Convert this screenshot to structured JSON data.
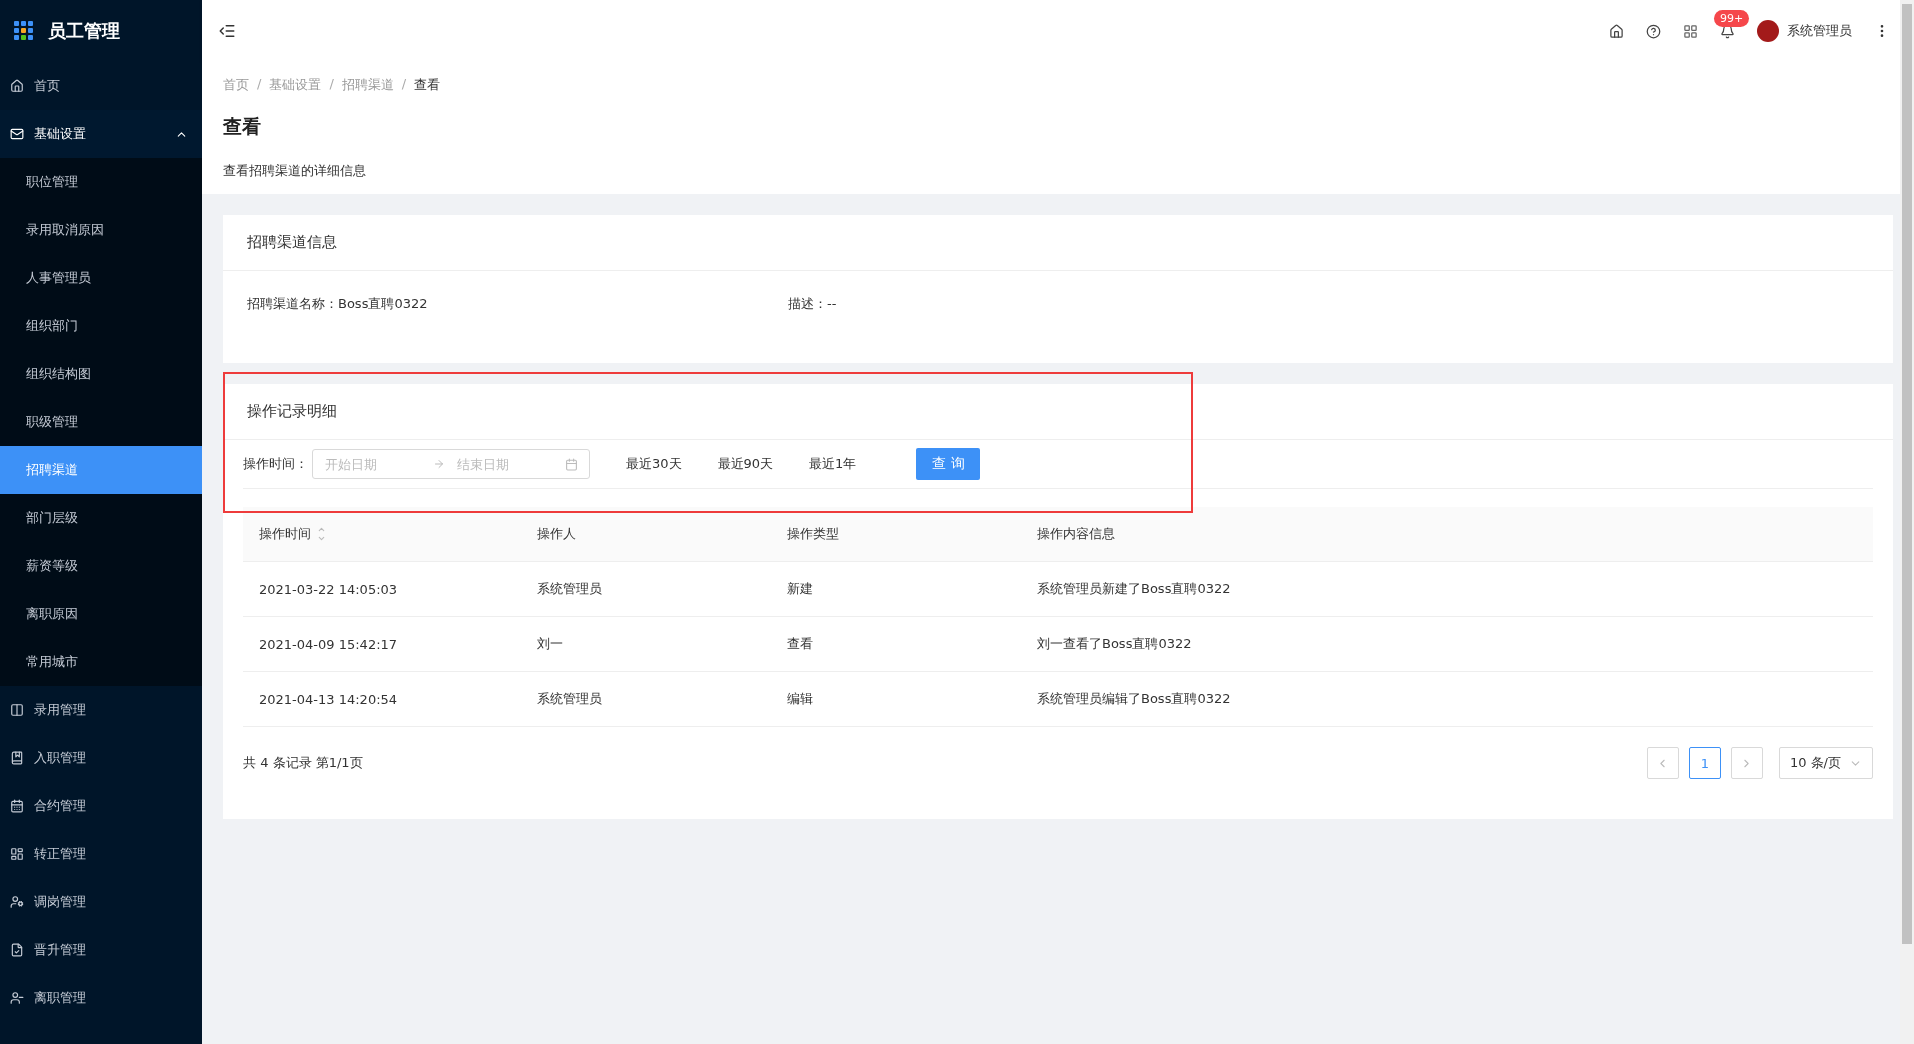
{
  "sidebar": {
    "logo": "员工管理",
    "items": [
      {
        "label": "首页",
        "expanded": false
      },
      {
        "label": "基础设置",
        "expanded": true,
        "children": [
          {
            "label": "职位管理",
            "selected": false
          },
          {
            "label": "录用取消原因",
            "selected": false
          },
          {
            "label": "人事管理员",
            "selected": false
          },
          {
            "label": "组织部门",
            "selected": false
          },
          {
            "label": "组织结构图",
            "selected": false
          },
          {
            "label": "职级管理",
            "selected": false
          },
          {
            "label": "招聘渠道",
            "selected": true
          },
          {
            "label": "部门层级",
            "selected": false
          },
          {
            "label": "薪资等级",
            "selected": false
          },
          {
            "label": "离职原因",
            "selected": false
          },
          {
            "label": "常用城市",
            "selected": false
          }
        ]
      },
      {
        "label": "录用管理",
        "expanded": false
      },
      {
        "label": "入职管理",
        "expanded": false
      },
      {
        "label": "合约管理",
        "expanded": false
      },
      {
        "label": "转正管理",
        "expanded": false
      },
      {
        "label": "调岗管理",
        "expanded": false
      },
      {
        "label": "晋升管理",
        "expanded": false
      },
      {
        "label": "离职管理",
        "expanded": false
      }
    ]
  },
  "header": {
    "notification_badge": "99+",
    "user": "系统管理员"
  },
  "breadcrumb": {
    "separator": "/",
    "items": [
      "首页",
      "基础设置",
      "招聘渠道",
      "查看"
    ]
  },
  "page_title": "查看",
  "page_subtitle": "查看招聘渠道的详细信息",
  "info_card": {
    "title": "招聘渠道信息",
    "fields": [
      {
        "label": "招聘渠道名称：",
        "value": "Boss直聘0322"
      },
      {
        "label": "描述：",
        "value": "--"
      }
    ]
  },
  "records_card": {
    "title": "操作记录明细",
    "filter": {
      "label": "操作时间：",
      "start_placeholder": "开始日期",
      "end_placeholder": "结束日期",
      "quick_ranges": [
        "最近30天",
        "最近90天",
        "最近1年"
      ],
      "query_button": "查 询"
    },
    "table": {
      "columns": [
        {
          "label": "操作时间",
          "sortable": true
        },
        {
          "label": "操作人",
          "sortable": false
        },
        {
          "label": "操作类型",
          "sortable": false
        },
        {
          "label": "操作内容信息",
          "sortable": false
        }
      ],
      "rows": [
        [
          "2021-03-22 14:05:03",
          "系统管理员",
          "新建",
          "系统管理员新建了Boss直聘0322"
        ],
        [
          "2021-04-09 15:42:17",
          "刘一",
          "查看",
          "刘一查看了Boss直聘0322"
        ],
        [
          "2021-04-13 14:20:54",
          "系统管理员",
          "编辑",
          "系统管理员编辑了Boss直聘0322"
        ]
      ]
    },
    "pagination": {
      "summary": "共 4 条记录 第1/1页",
      "pages": [
        {
          "label": "1",
          "selected": true
        }
      ],
      "page_size": "10 条/页"
    }
  }
}
